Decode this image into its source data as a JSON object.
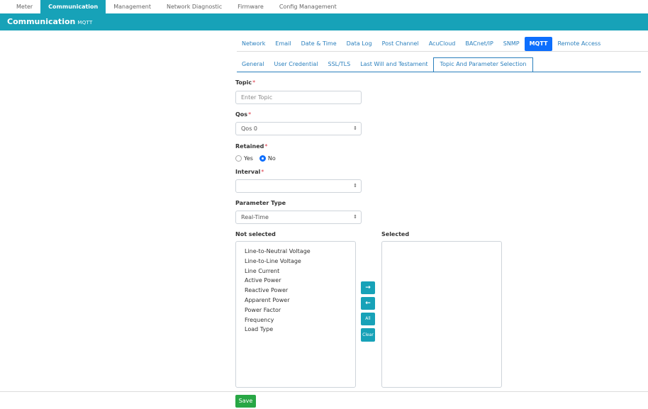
{
  "topnav": {
    "items": [
      "Meter",
      "Communication",
      "Management",
      "Network Diagnostic",
      "Firmware",
      "Config Management"
    ],
    "active": 1
  },
  "title": {
    "main": "Communication",
    "sub": "MQTT"
  },
  "tabs": [
    "Network",
    "Email",
    "Date & Time",
    "Data Log",
    "Post Channel",
    "AcuCloud",
    "BACnet/IP",
    "SNMP",
    "MQTT",
    "Remote Access"
  ],
  "tabs_active": 8,
  "subtabs": [
    "General",
    "User Credential",
    "SSL/TLS",
    "Last Will and Testament",
    "Topic And Parameter Selection"
  ],
  "subtabs_active": 4,
  "form": {
    "topic_label": "Topic",
    "topic_placeholder": "Enter Topic",
    "qos_label": "Qos",
    "qos_value": "Qos 0",
    "retained_label": "Retained",
    "retained_yes": "Yes",
    "retained_no": "No",
    "retained_selected": "No",
    "interval_label": "Interval",
    "interval_value": "",
    "param_type_label": "Parameter Type",
    "param_type_value": "Real-Time",
    "required_mark": "*",
    "select_arrows": "⇕"
  },
  "lists": {
    "not_selected_label": "Not selected",
    "selected_label": "Selected",
    "not_selected": [
      "Line-to-Neutral Voltage",
      "Line-to-Line Voltage",
      "Line Current",
      "Active Power",
      "Reactive Power",
      "Apparent Power",
      "Power Factor",
      "Frequency",
      "Load Type"
    ],
    "selected": []
  },
  "buttons": {
    "move_right": "→",
    "move_left": "←",
    "all": "All",
    "clear": "Clear",
    "save": "Save"
  }
}
